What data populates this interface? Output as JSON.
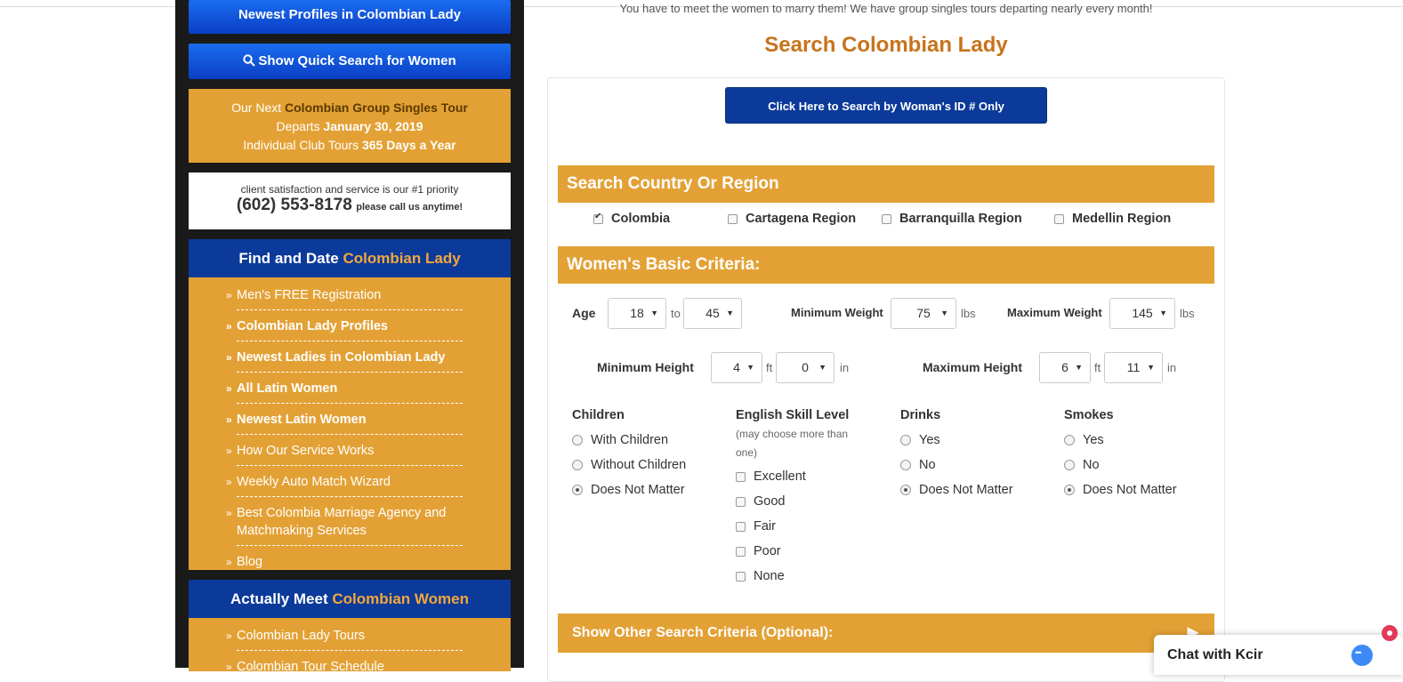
{
  "sidebar": {
    "newest_btn": "Newest Profiles in Colombian Lady",
    "quick_search_btn": "Show Quick Search for Women",
    "tour": {
      "line1_prefix": "Our Next ",
      "line1_highlight": "Colombian Group Singles Tour",
      "line2_prefix": "Departs ",
      "line2_date": "January 30, 2019",
      "line3_prefix": "Individual Club Tours ",
      "line3_bold": "365 Days a Year"
    },
    "phone": {
      "line1": "client satisfaction and service is our #1 priority",
      "number": "(602) 553-8178",
      "call": "please call us anytime!"
    },
    "find_panel": {
      "title_prefix": "Find and Date ",
      "title_highlight": "Colombian Lady",
      "items": [
        "Men's FREE Registration",
        "Colombian Lady Profiles",
        "Newest Ladies in Colombian Lady",
        "All Latin Women",
        "Newest Latin Women",
        "How Our Service Works",
        "Weekly Auto Match Wizard",
        "Best Colombia Marriage Agency and Matchmaking Services",
        "Blog"
      ]
    },
    "meet_panel": {
      "title_prefix": "Actually Meet ",
      "title_highlight": "Colombian Women",
      "items": [
        "Colombian Lady Tours",
        "Colombian Tour Schedule"
      ]
    }
  },
  "main": {
    "intro": "You have to meet the women to marry them! We have group singles tours departing nearly every month!",
    "title": "Search Colombian Lady",
    "id_search_btn": "Click Here to Search by Woman's ID # Only",
    "country_section": {
      "title": "Search Country Or Region",
      "options": [
        "Colombia",
        "Cartagena Region",
        "Barranquilla Region",
        "Medellin Region"
      ],
      "checked": "Colombia"
    },
    "basic_section": {
      "title": "Women's Basic Criteria:",
      "age_label": "Age",
      "age_from": "18",
      "to": "to",
      "age_to": "45",
      "min_weight_label": "Minimum Weight",
      "min_weight": "75",
      "max_weight_label": "Maximum Weight",
      "max_weight": "145",
      "lbs": "lbs",
      "min_height_label": "Minimum Height",
      "min_height_ft": "4",
      "min_height_in": "0",
      "max_height_label": "Maximum Height",
      "max_height_ft": "6",
      "max_height_in": "11",
      "ft": "ft",
      "in": "in"
    },
    "children": {
      "label": "Children",
      "options": [
        "With Children",
        "Without Children",
        "Does Not Matter"
      ],
      "selected": "Does Not Matter"
    },
    "english": {
      "label": "English Skill Level",
      "note": "(may choose more than one)",
      "options": [
        "Excellent",
        "Good",
        "Fair",
        "Poor",
        "None"
      ]
    },
    "drinks": {
      "label": "Drinks",
      "options": [
        "Yes",
        "No",
        "Does Not Matter"
      ],
      "selected": "Does Not Matter"
    },
    "smokes": {
      "label": "Smokes",
      "options": [
        "Yes",
        "No",
        "Does Not Matter"
      ],
      "selected": "Does Not Matter"
    },
    "other_section": {
      "title": "Show Other Search Criteria (Optional):"
    }
  },
  "chat": {
    "title": "Chat with Kcir"
  }
}
